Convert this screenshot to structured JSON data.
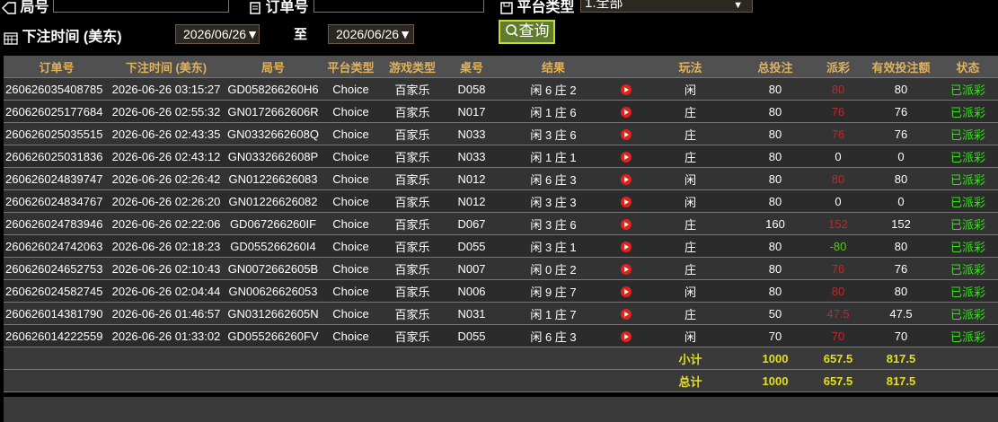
{
  "header": {
    "round_label": "局号",
    "order_label": "订单号",
    "platform_label": "平台类型",
    "platform_selected": "1.全部",
    "bet_time_label": "下注时间 (美东)",
    "date_from": "2026/06/26",
    "to_label": "至",
    "date_to": "2026/06/26",
    "query_label": "查询"
  },
  "table": {
    "columns": [
      "订单号",
      "下注时间 (美东)",
      "局号",
      "平台类型",
      "游戏类型",
      "桌号",
      "结果",
      "",
      "玩法",
      "总投注",
      "派彩",
      "有效投注额",
      "状态"
    ],
    "rows": [
      {
        "order": "260626035408785",
        "time": "2026-06-26 03:15:27",
        "round": "GD058266260H6",
        "platform": "Choice",
        "game": "百家乐",
        "table": "D058",
        "result": "闲 6 庄 2",
        "play": "闲",
        "total": "80",
        "payout": "80",
        "payout_type": "red",
        "valid": "80",
        "status": "已派彩"
      },
      {
        "order": "260626025177684",
        "time": "2026-06-26 02:55:32",
        "round": "GN0172662606R",
        "platform": "Choice",
        "game": "百家乐",
        "table": "N017",
        "result": "闲 1 庄 6",
        "play": "庄",
        "total": "80",
        "payout": "76",
        "payout_type": "red",
        "valid": "76",
        "status": "已派彩"
      },
      {
        "order": "260626025035515",
        "time": "2026-06-26 02:43:35",
        "round": "GN0332662608Q",
        "platform": "Choice",
        "game": "百家乐",
        "table": "N033",
        "result": "闲 3 庄 6",
        "play": "庄",
        "total": "80",
        "payout": "76",
        "payout_type": "red",
        "valid": "76",
        "status": "已派彩"
      },
      {
        "order": "260626025031836",
        "time": "2026-06-26 02:43:12",
        "round": "GN0332662608P",
        "platform": "Choice",
        "game": "百家乐",
        "table": "N033",
        "result": "闲 1 庄 1",
        "play": "庄",
        "total": "80",
        "payout": "0",
        "payout_type": "white",
        "valid": "0",
        "status": "已派彩"
      },
      {
        "order": "260626024839747",
        "time": "2026-06-26 02:26:42",
        "round": "GN01226626083",
        "platform": "Choice",
        "game": "百家乐",
        "table": "N012",
        "result": "闲 6 庄 3",
        "play": "闲",
        "total": "80",
        "payout": "80",
        "payout_type": "red",
        "valid": "80",
        "status": "已派彩"
      },
      {
        "order": "260626024834767",
        "time": "2026-06-26 02:26:20",
        "round": "GN01226626082",
        "platform": "Choice",
        "game": "百家乐",
        "table": "N012",
        "result": "闲 3 庄 3",
        "play": "闲",
        "total": "80",
        "payout": "0",
        "payout_type": "white",
        "valid": "0",
        "status": "已派彩"
      },
      {
        "order": "260626024783946",
        "time": "2026-06-26 02:22:06",
        "round": "GD067266260IF",
        "platform": "Choice",
        "game": "百家乐",
        "table": "D067",
        "result": "闲 3 庄 6",
        "play": "庄",
        "total": "160",
        "payout": "152",
        "payout_type": "red",
        "valid": "152",
        "status": "已派彩"
      },
      {
        "order": "260626024742063",
        "time": "2026-06-26 02:18:23",
        "round": "GD055266260I4",
        "platform": "Choice",
        "game": "百家乐",
        "table": "D055",
        "result": "闲 3 庄 1",
        "play": "庄",
        "total": "80",
        "payout": "-80",
        "payout_type": "green",
        "valid": "80",
        "status": "已派彩"
      },
      {
        "order": "260626024652753",
        "time": "2026-06-26 02:10:43",
        "round": "GN0072662605B",
        "platform": "Choice",
        "game": "百家乐",
        "table": "N007",
        "result": "闲 0 庄 2",
        "play": "庄",
        "total": "80",
        "payout": "76",
        "payout_type": "red",
        "valid": "76",
        "status": "已派彩"
      },
      {
        "order": "260626024582745",
        "time": "2026-06-26 02:04:44",
        "round": "GN00626626053",
        "platform": "Choice",
        "game": "百家乐",
        "table": "N006",
        "result": "闲 9 庄 7",
        "play": "闲",
        "total": "80",
        "payout": "80",
        "payout_type": "red",
        "valid": "80",
        "status": "已派彩"
      },
      {
        "order": "260626014381790",
        "time": "2026-06-26 01:46:57",
        "round": "GN0312662605N",
        "platform": "Choice",
        "game": "百家乐",
        "table": "N031",
        "result": "闲 1 庄 7",
        "play": "庄",
        "total": "50",
        "payout": "47.5",
        "payout_type": "red",
        "valid": "47.5",
        "status": "已派彩"
      },
      {
        "order": "260626014222559",
        "time": "2026-06-26 01:33:02",
        "round": "GD055266260FV",
        "platform": "Choice",
        "game": "百家乐",
        "table": "D055",
        "result": "闲 6 庄 3",
        "play": "闲",
        "total": "70",
        "payout": "70",
        "payout_type": "red",
        "valid": "70",
        "status": "已派彩"
      }
    ],
    "subtotal": {
      "label": "小计",
      "total": "1000",
      "payout": "657.5",
      "valid": "817.5"
    },
    "grand_total": {
      "label": "总计",
      "total": "1000",
      "payout": "657.5",
      "valid": "817.5"
    }
  },
  "colors": {
    "header_text": "#e0b25a",
    "payout_win": "#c4262b",
    "payout_loss": "#58c71c",
    "status": "#3adc21",
    "summary": "#e6df1b"
  }
}
